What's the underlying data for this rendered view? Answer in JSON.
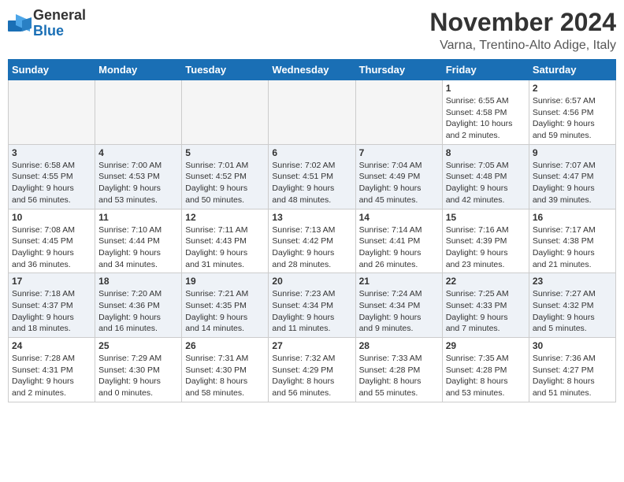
{
  "header": {
    "logo_general": "General",
    "logo_blue": "Blue",
    "month": "November 2024",
    "location": "Varna, Trentino-Alto Adige, Italy"
  },
  "weekdays": [
    "Sunday",
    "Monday",
    "Tuesday",
    "Wednesday",
    "Thursday",
    "Friday",
    "Saturday"
  ],
  "weeks": [
    [
      {
        "day": "",
        "info": ""
      },
      {
        "day": "",
        "info": ""
      },
      {
        "day": "",
        "info": ""
      },
      {
        "day": "",
        "info": ""
      },
      {
        "day": "",
        "info": ""
      },
      {
        "day": "1",
        "info": "Sunrise: 6:55 AM\nSunset: 4:58 PM\nDaylight: 10 hours\nand 2 minutes."
      },
      {
        "day": "2",
        "info": "Sunrise: 6:57 AM\nSunset: 4:56 PM\nDaylight: 9 hours\nand 59 minutes."
      }
    ],
    [
      {
        "day": "3",
        "info": "Sunrise: 6:58 AM\nSunset: 4:55 PM\nDaylight: 9 hours\nand 56 minutes."
      },
      {
        "day": "4",
        "info": "Sunrise: 7:00 AM\nSunset: 4:53 PM\nDaylight: 9 hours\nand 53 minutes."
      },
      {
        "day": "5",
        "info": "Sunrise: 7:01 AM\nSunset: 4:52 PM\nDaylight: 9 hours\nand 50 minutes."
      },
      {
        "day": "6",
        "info": "Sunrise: 7:02 AM\nSunset: 4:51 PM\nDaylight: 9 hours\nand 48 minutes."
      },
      {
        "day": "7",
        "info": "Sunrise: 7:04 AM\nSunset: 4:49 PM\nDaylight: 9 hours\nand 45 minutes."
      },
      {
        "day": "8",
        "info": "Sunrise: 7:05 AM\nSunset: 4:48 PM\nDaylight: 9 hours\nand 42 minutes."
      },
      {
        "day": "9",
        "info": "Sunrise: 7:07 AM\nSunset: 4:47 PM\nDaylight: 9 hours\nand 39 minutes."
      }
    ],
    [
      {
        "day": "10",
        "info": "Sunrise: 7:08 AM\nSunset: 4:45 PM\nDaylight: 9 hours\nand 36 minutes."
      },
      {
        "day": "11",
        "info": "Sunrise: 7:10 AM\nSunset: 4:44 PM\nDaylight: 9 hours\nand 34 minutes."
      },
      {
        "day": "12",
        "info": "Sunrise: 7:11 AM\nSunset: 4:43 PM\nDaylight: 9 hours\nand 31 minutes."
      },
      {
        "day": "13",
        "info": "Sunrise: 7:13 AM\nSunset: 4:42 PM\nDaylight: 9 hours\nand 28 minutes."
      },
      {
        "day": "14",
        "info": "Sunrise: 7:14 AM\nSunset: 4:41 PM\nDaylight: 9 hours\nand 26 minutes."
      },
      {
        "day": "15",
        "info": "Sunrise: 7:16 AM\nSunset: 4:39 PM\nDaylight: 9 hours\nand 23 minutes."
      },
      {
        "day": "16",
        "info": "Sunrise: 7:17 AM\nSunset: 4:38 PM\nDaylight: 9 hours\nand 21 minutes."
      }
    ],
    [
      {
        "day": "17",
        "info": "Sunrise: 7:18 AM\nSunset: 4:37 PM\nDaylight: 9 hours\nand 18 minutes."
      },
      {
        "day": "18",
        "info": "Sunrise: 7:20 AM\nSunset: 4:36 PM\nDaylight: 9 hours\nand 16 minutes."
      },
      {
        "day": "19",
        "info": "Sunrise: 7:21 AM\nSunset: 4:35 PM\nDaylight: 9 hours\nand 14 minutes."
      },
      {
        "day": "20",
        "info": "Sunrise: 7:23 AM\nSunset: 4:34 PM\nDaylight: 9 hours\nand 11 minutes."
      },
      {
        "day": "21",
        "info": "Sunrise: 7:24 AM\nSunset: 4:34 PM\nDaylight: 9 hours\nand 9 minutes."
      },
      {
        "day": "22",
        "info": "Sunrise: 7:25 AM\nSunset: 4:33 PM\nDaylight: 9 hours\nand 7 minutes."
      },
      {
        "day": "23",
        "info": "Sunrise: 7:27 AM\nSunset: 4:32 PM\nDaylight: 9 hours\nand 5 minutes."
      }
    ],
    [
      {
        "day": "24",
        "info": "Sunrise: 7:28 AM\nSunset: 4:31 PM\nDaylight: 9 hours\nand 2 minutes."
      },
      {
        "day": "25",
        "info": "Sunrise: 7:29 AM\nSunset: 4:30 PM\nDaylight: 9 hours\nand 0 minutes."
      },
      {
        "day": "26",
        "info": "Sunrise: 7:31 AM\nSunset: 4:30 PM\nDaylight: 8 hours\nand 58 minutes."
      },
      {
        "day": "27",
        "info": "Sunrise: 7:32 AM\nSunset: 4:29 PM\nDaylight: 8 hours\nand 56 minutes."
      },
      {
        "day": "28",
        "info": "Sunrise: 7:33 AM\nSunset: 4:28 PM\nDaylight: 8 hours\nand 55 minutes."
      },
      {
        "day": "29",
        "info": "Sunrise: 7:35 AM\nSunset: 4:28 PM\nDaylight: 8 hours\nand 53 minutes."
      },
      {
        "day": "30",
        "info": "Sunrise: 7:36 AM\nSunset: 4:27 PM\nDaylight: 8 hours\nand 51 minutes."
      }
    ]
  ]
}
